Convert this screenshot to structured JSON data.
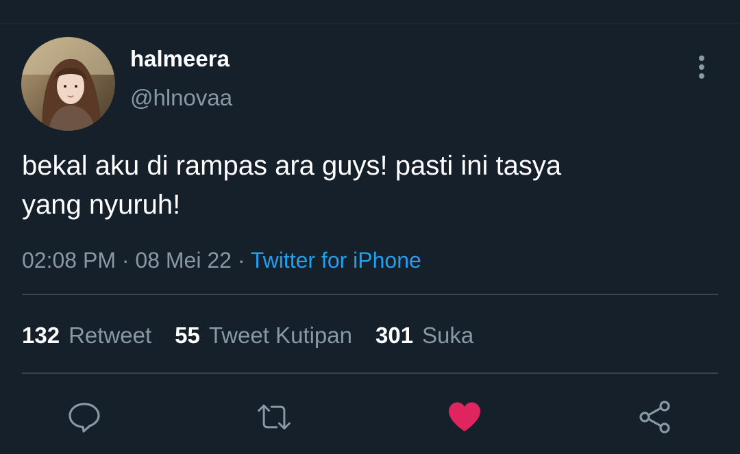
{
  "user": {
    "display_name": "halmeera",
    "handle": "@hlnovaa"
  },
  "tweet": {
    "text_line1": "bekal aku di rampas ara guys! pasti ini tasya",
    "text_line2": "yang nyuruh!",
    "time": "02:08 PM",
    "separator1": " · ",
    "date": "08 Mei 22",
    "separator2": " · ",
    "source": "Twitter for iPhone"
  },
  "stats": [
    {
      "count": "132",
      "label": "Retweet"
    },
    {
      "count": "55",
      "label": "Tweet Kutipan"
    },
    {
      "count": "301",
      "label": "Suka"
    }
  ],
  "actions": {
    "reply_icon": "reply-icon",
    "retweet_icon": "retweet-icon",
    "like_icon": "heart-icon",
    "like_state": "liked",
    "share_icon": "share-icon"
  },
  "colors": {
    "background": "#15202b",
    "secondary_text": "#8899a6",
    "link": "#1da1f2",
    "like": "#e0245e",
    "divider": "#38444d"
  }
}
